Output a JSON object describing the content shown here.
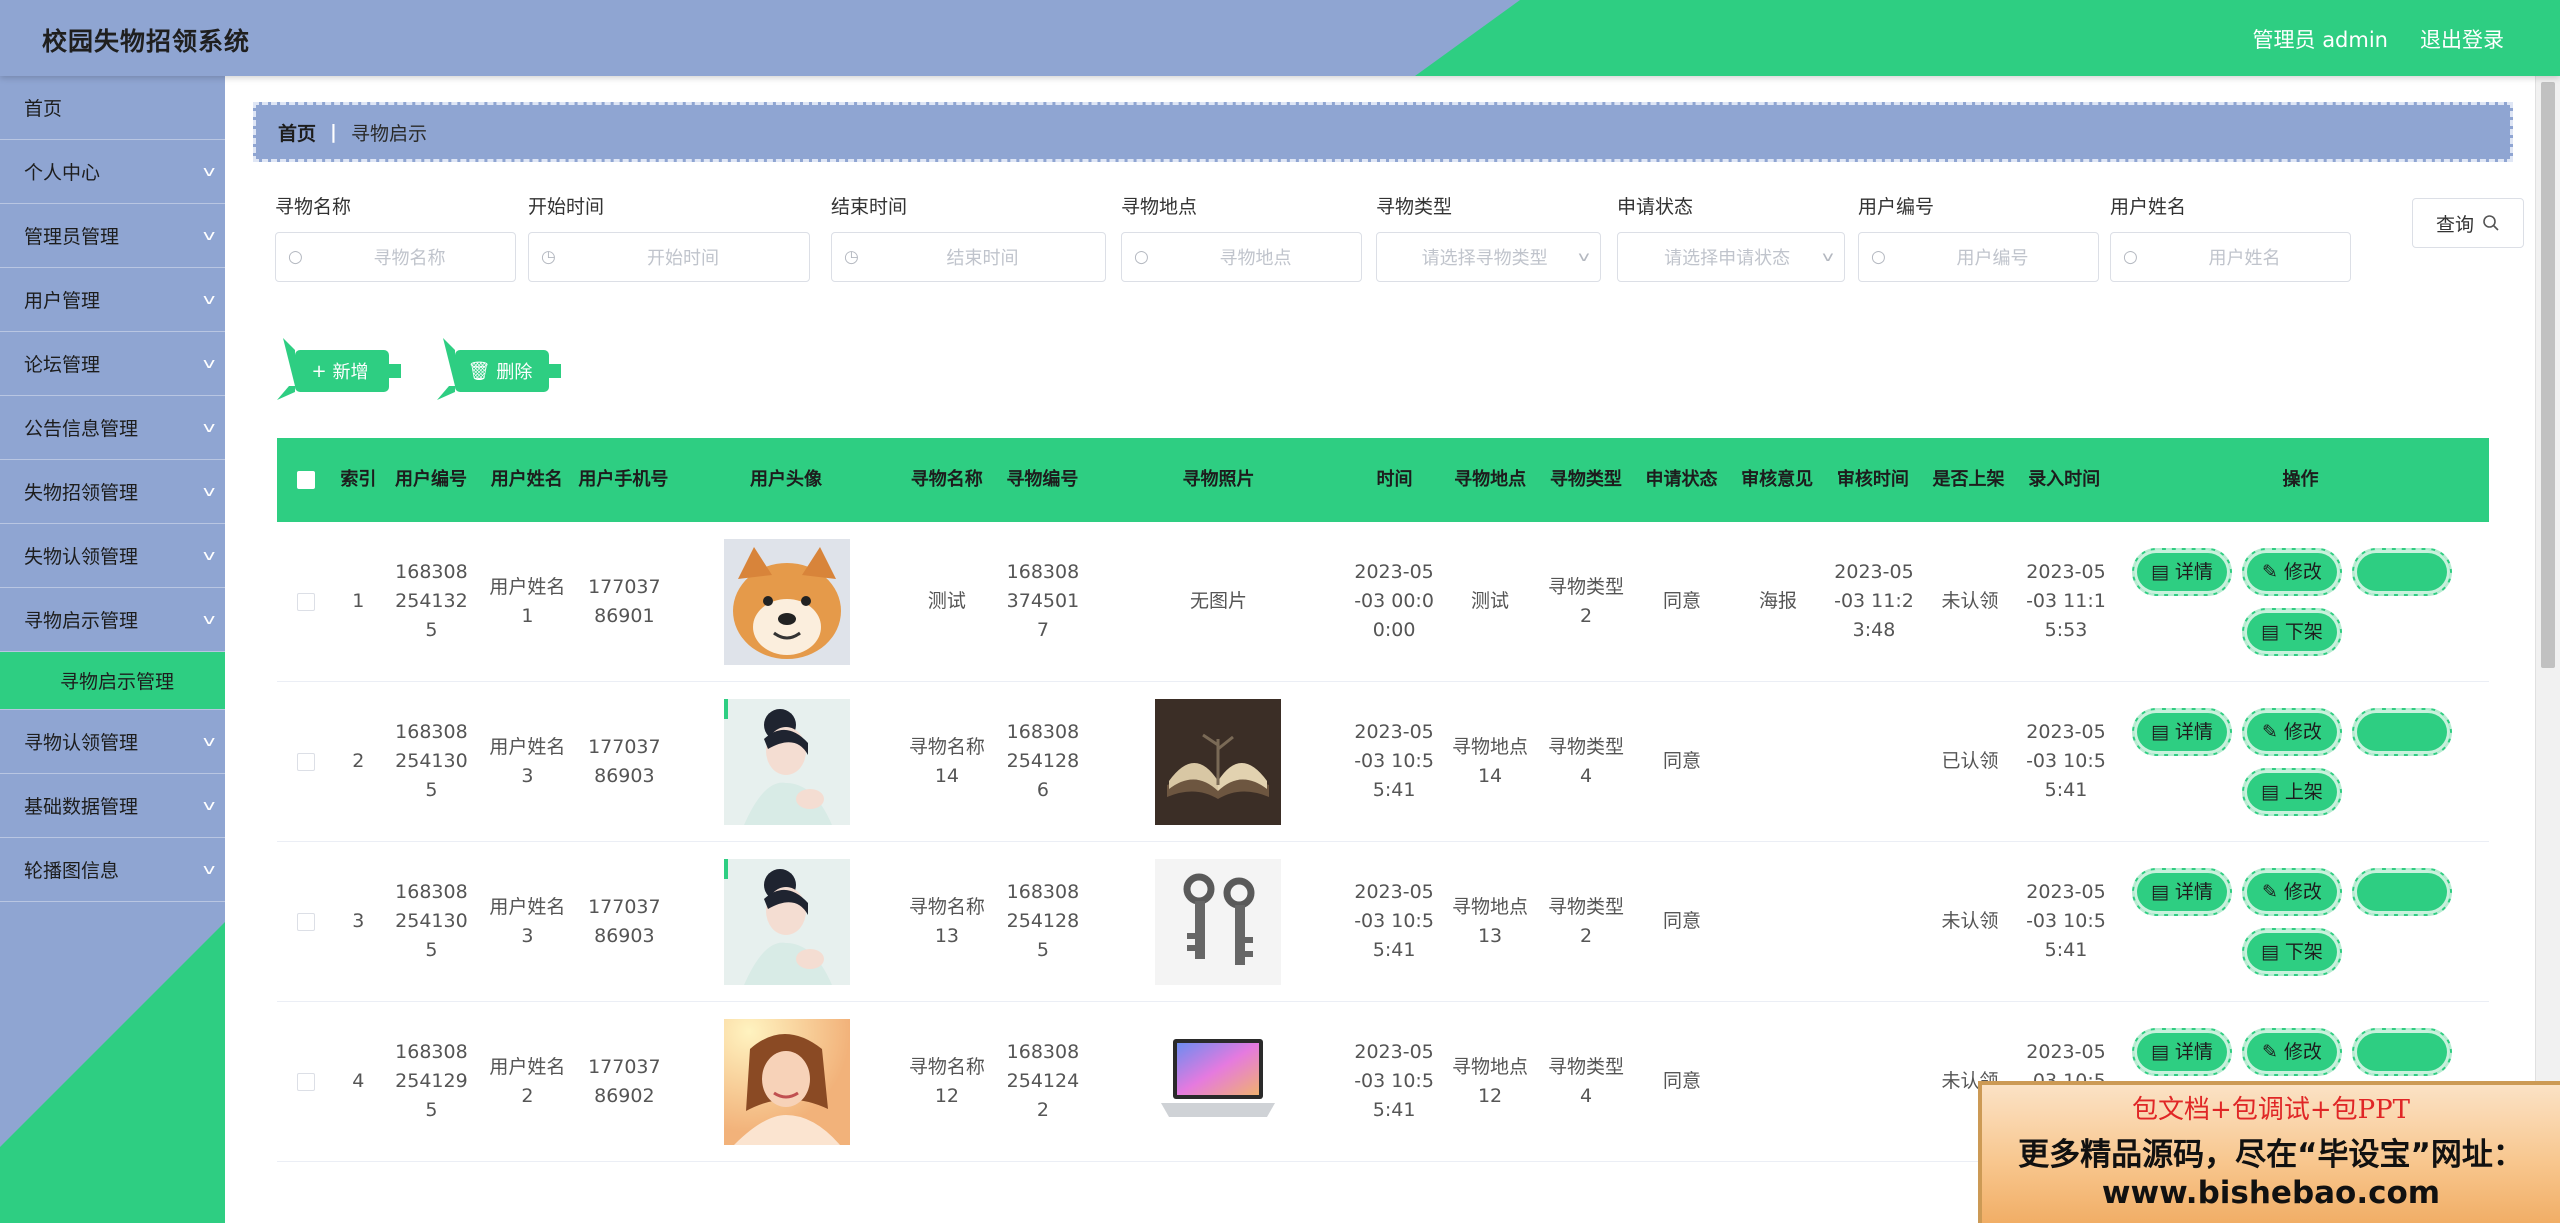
{
  "header": {
    "title": "校园失物招领系统",
    "user_label": "管理员 admin",
    "logout_label": "退出登录"
  },
  "colors": {
    "accent": "#2ece82",
    "sidebar": "#8fa5d2"
  },
  "sidebar": {
    "items": [
      {
        "label": "首页"
      },
      {
        "label": "个人中心"
      },
      {
        "label": "管理员管理"
      },
      {
        "label": "用户管理"
      },
      {
        "label": "论坛管理"
      },
      {
        "label": "公告信息管理"
      },
      {
        "label": "失物招领管理"
      },
      {
        "label": "失物认领管理"
      },
      {
        "label": "寻物启示管理"
      },
      {
        "label": "寻物认领管理"
      },
      {
        "label": "基础数据管理"
      },
      {
        "label": "轮播图信息"
      }
    ],
    "active_sub": "寻物启示管理"
  },
  "breadcrumb": {
    "home": "首页",
    "current": "寻物启示"
  },
  "search": {
    "fields": [
      {
        "label": "寻物名称",
        "placeholder": "寻物名称",
        "icon": "search-icon"
      },
      {
        "label": "开始时间",
        "placeholder": "开始时间",
        "icon": "clock-icon"
      },
      {
        "label": "结束时间",
        "placeholder": "结束时间",
        "icon": "clock-icon"
      },
      {
        "label": "寻物地点",
        "placeholder": "寻物地点",
        "icon": "search-icon"
      },
      {
        "label": "寻物类型",
        "placeholder": "请选择寻物类型",
        "icon": "chevron-down-icon"
      },
      {
        "label": "申请状态",
        "placeholder": "请选择申请状态",
        "icon": "chevron-down-icon"
      },
      {
        "label": "用户编号",
        "placeholder": "用户编号",
        "icon": "search-icon"
      },
      {
        "label": "用户姓名",
        "placeholder": "用户姓名",
        "icon": "search-icon"
      }
    ],
    "query_label": "查询"
  },
  "actions": {
    "add_label": "新增",
    "delete_label": "删除"
  },
  "table": {
    "headers": {
      "index": "索引",
      "user_id": "用户编号",
      "user_name": "用户姓名",
      "phone": "用户手机号",
      "avatar": "用户头像",
      "lost_name": "寻物名称",
      "lost_id": "寻物编号",
      "photo": "寻物照片",
      "time": "时间",
      "place": "寻物地点",
      "type": "寻物类型",
      "status": "申请状态",
      "review": "审核意见",
      "review_time": "审核时间",
      "shelf": "是否上架",
      "created": "录入时间",
      "ops": "操作"
    },
    "op_labels": {
      "detail": "详情",
      "edit": "修改"
    },
    "rows": [
      {
        "index": "1",
        "user_id": "1683082541325",
        "user_name": "用户姓名1",
        "phone": "17703786901",
        "avatar": "shiba",
        "lost_name": "测试",
        "lost_id": "1683083745017",
        "photo_text": "无图片",
        "photo": "none",
        "time": "2023-05-03 00:00:00",
        "place": "测试",
        "type": "寻物类型2",
        "status": "同意",
        "review": "海报",
        "review_time": "2023-05-03 11:23:48",
        "shelf": "未认领",
        "created": "2023-05-03 11:15:53",
        "shelf_op": "下架"
      },
      {
        "index": "2",
        "user_id": "1683082541305",
        "user_name": "用户姓名3",
        "phone": "17703786903",
        "avatar": "woman1",
        "lost_name": "寻物名称14",
        "lost_id": "1683082541286",
        "photo_text": "",
        "photo": "book",
        "time": "2023-05-03 10:55:41",
        "place": "寻物地点14",
        "type": "寻物类型4",
        "status": "同意",
        "review": "",
        "review_time": "",
        "shelf": "已认领",
        "created": "2023-05-03 10:55:41",
        "shelf_op": "上架"
      },
      {
        "index": "3",
        "user_id": "1683082541305",
        "user_name": "用户姓名3",
        "phone": "17703786903",
        "avatar": "woman1",
        "lost_name": "寻物名称13",
        "lost_id": "1683082541285",
        "photo_text": "",
        "photo": "keys",
        "time": "2023-05-03 10:55:41",
        "place": "寻物地点13",
        "type": "寻物类型2",
        "status": "同意",
        "review": "",
        "review_time": "",
        "shelf": "未认领",
        "created": "2023-05-03 10:55:41",
        "shelf_op": "下架"
      },
      {
        "index": "4",
        "user_id": "1683082541295",
        "user_name": "用户姓名2",
        "phone": "17703786902",
        "avatar": "woman2",
        "lost_name": "寻物名称12",
        "lost_id": "1683082541242",
        "photo_text": "",
        "photo": "laptop",
        "time": "2023-05-03 10:55:41",
        "place": "寻物地点12",
        "type": "寻物类型4",
        "status": "同意",
        "review": "",
        "review_time": "",
        "shelf": "未认领",
        "created": "2023-05-03 10:55:41",
        "shelf_op": ""
      }
    ]
  },
  "promo": {
    "line1": "包文档+包调试+包PPT",
    "line2": "更多精品源码，尽在“毕设宝”网址：",
    "line3": "www.bishebao.com"
  }
}
